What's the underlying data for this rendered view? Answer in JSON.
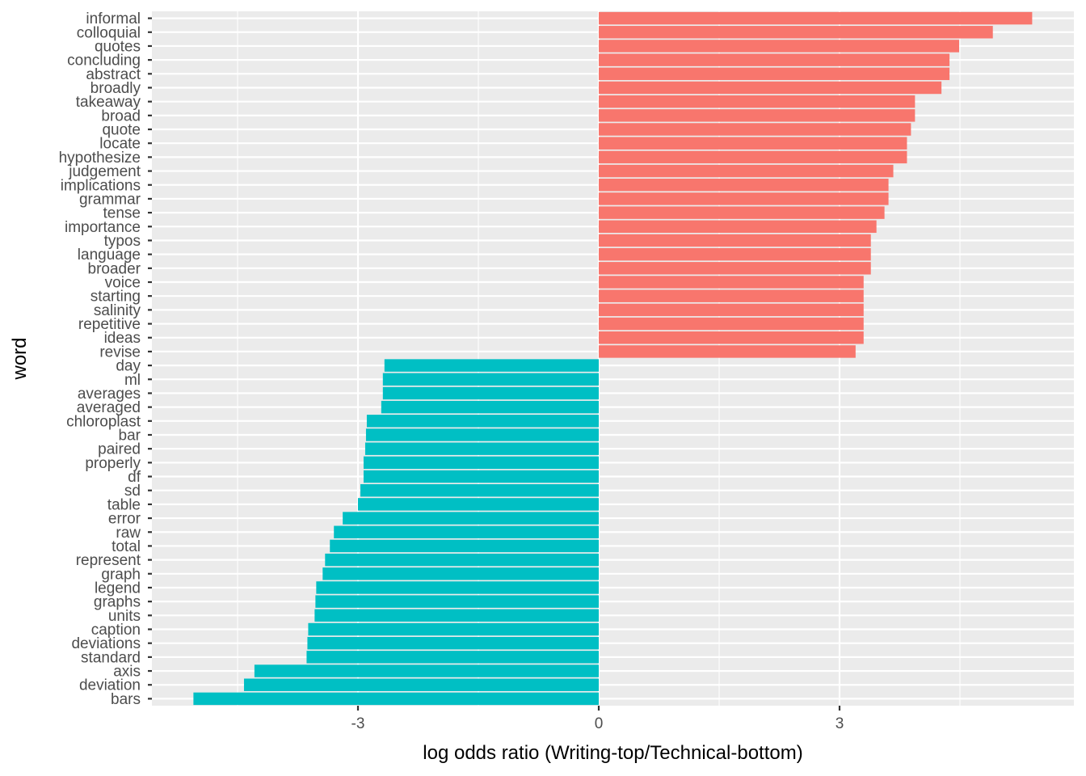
{
  "chart_data": {
    "type": "bar",
    "orientation": "horizontal",
    "title": "",
    "xlabel": "log odds ratio (Writing-top/Technical-bottom)",
    "ylabel": "word",
    "xlim": [
      -5.5,
      5.9
    ],
    "xticks": [
      -3,
      0,
      3
    ],
    "xtick_labels": [
      "-3",
      "0",
      "3"
    ],
    "grid": true,
    "legend": "none",
    "colors": {
      "positive": "#F8766D",
      "negative": "#00BFC4",
      "panel": "#EBEBEB",
      "grid": "#FFFFFF"
    },
    "categories": [
      "informal",
      "colloquial",
      "quotes",
      "concluding",
      "abstract",
      "broadly",
      "takeaway",
      "broad",
      "quote",
      "locate",
      "hypothesize",
      "judgement",
      "implications",
      "grammar",
      "tense",
      "importance",
      "typos",
      "language",
      "broader",
      "voice",
      "starting",
      "salinity",
      "repetitive",
      "ideas",
      "revise",
      "day",
      "ml",
      "averages",
      "averaged",
      "chloroplast",
      "bar",
      "paired",
      "properly",
      "df",
      "sd",
      "table",
      "error",
      "raw",
      "total",
      "represent",
      "graph",
      "legend",
      "graphs",
      "units",
      "caption",
      "deviations",
      "standard",
      "axis",
      "deviation",
      "bars"
    ],
    "values": [
      5.4,
      4.91,
      4.49,
      4.37,
      4.37,
      4.27,
      3.94,
      3.94,
      3.89,
      3.84,
      3.84,
      3.67,
      3.61,
      3.61,
      3.56,
      3.46,
      3.39,
      3.39,
      3.39,
      3.3,
      3.3,
      3.3,
      3.3,
      3.3,
      3.2,
      -2.67,
      -2.69,
      -2.69,
      -2.71,
      -2.89,
      -2.9,
      -2.91,
      -2.93,
      -2.93,
      -2.97,
      -3.0,
      -3.19,
      -3.3,
      -3.35,
      -3.41,
      -3.44,
      -3.52,
      -3.53,
      -3.54,
      -3.62,
      -3.63,
      -3.64,
      -4.29,
      -4.42,
      -5.05
    ]
  }
}
